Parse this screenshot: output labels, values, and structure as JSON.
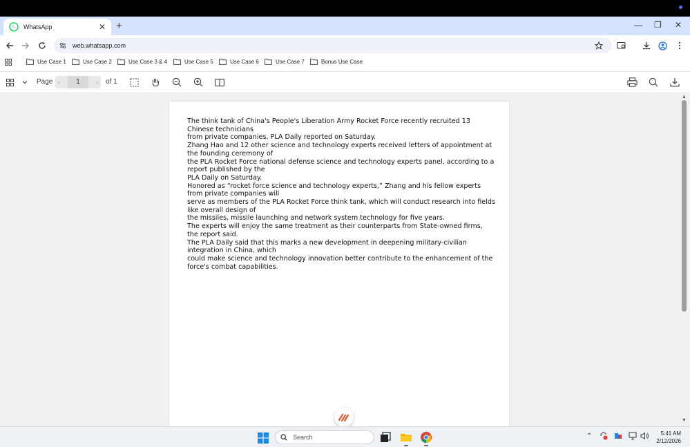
{
  "browser": {
    "tab": {
      "title": "WhatsApp",
      "close": "✕"
    },
    "new_tab": "+",
    "window_controls": {
      "minimize": "—",
      "restore": "❐",
      "close": "✕"
    },
    "url": "web.whatsapp.com"
  },
  "bookmarks": [
    {
      "label": "Use Case 1"
    },
    {
      "label": "Use Case 2"
    },
    {
      "label": "Use Case 3 & 4"
    },
    {
      "label": "Use Case 5"
    },
    {
      "label": "Use Case 6"
    },
    {
      "label": "Use Case 7"
    },
    {
      "label": "Bonus Use Case"
    }
  ],
  "pdf": {
    "page_label": "Page",
    "page_value": "1",
    "of_label": "of 1"
  },
  "document": {
    "lines": [
      "The think tank of China's People's Liberation Army Rocket Force recently recruited 13 Chinese technicians",
      "from private companies, PLA Daily reported on Saturday.",
      "Zhang Hao and 12 other science and technology experts received letters of appointment at the founding ceremony of",
      "the PLA Rocket Force national defense science and technology experts panel, according to a report published by the",
      "PLA Daily on Saturday.",
      "Honored as “rocket force science and technology experts,” Zhang and his fellow experts from private companies will",
      "serve as members of the PLA Rocket Force think tank, which will conduct research into fields like overall design of",
      "the missiles, missile launching and network system technology for five years.",
      "The experts will enjoy the same treatment as their counterparts from State-owned firms, the report said.",
      "The PLA Daily said that this marks a new development in deepening military-civilian integration in China, which",
      "could make science and technology innovation better contribute to the enhancement of the force's combat capabilities."
    ]
  },
  "taskbar": {
    "search_placeholder": "Search",
    "time": "5:41 AM",
    "date": "2/12/2026"
  },
  "colors": {
    "tab_strip": "#d3e3fd",
    "viewer_bg": "#f1f1f1",
    "whatsapp_green": "#25d366"
  }
}
